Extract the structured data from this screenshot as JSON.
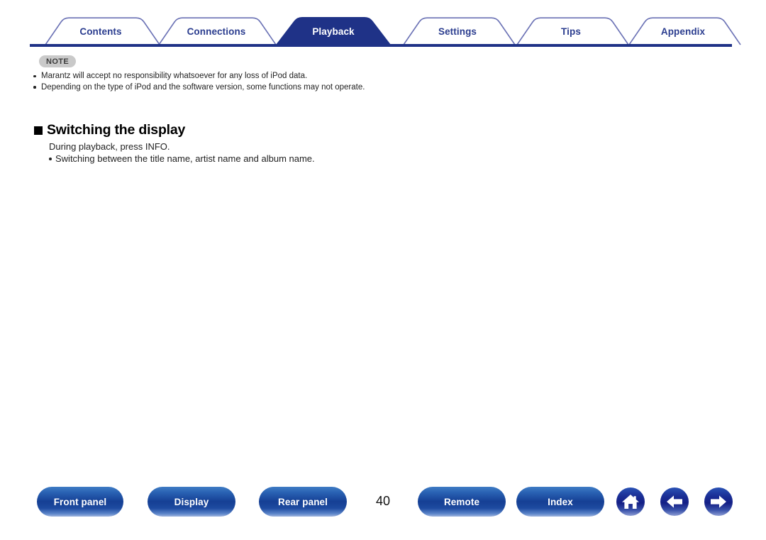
{
  "tabs": [
    {
      "label": "Contents",
      "active": false
    },
    {
      "label": "Connections",
      "active": false
    },
    {
      "label": "Playback",
      "active": true
    },
    {
      "label": "Settings",
      "active": false
    },
    {
      "label": "Tips",
      "active": false
    },
    {
      "label": "Appendix",
      "active": false
    }
  ],
  "note": {
    "badge_label": "NOTE",
    "items": [
      "Marantz will accept no responsibility whatsoever for any loss of iPod data.",
      "Depending on the type of iPod and the software version, some functions may not operate."
    ]
  },
  "section": {
    "heading": "Switching the display",
    "line1": "During playback, press INFO.",
    "line2": "Switching between the title name, artist name and album name."
  },
  "footer": {
    "page_number": "40",
    "buttons": [
      {
        "label": "Front panel"
      },
      {
        "label": "Display"
      },
      {
        "label": "Rear panel"
      },
      {
        "label": "Remote"
      },
      {
        "label": "Index"
      }
    ],
    "icons": [
      {
        "name": "home-icon"
      },
      {
        "name": "arrow-left-icon"
      },
      {
        "name": "arrow-right-icon"
      }
    ]
  },
  "colors": {
    "tab_active_bg": "#1f3287",
    "tab_inactive_text": "#2b3d8f",
    "tab_border": "#6b72b5",
    "baseline": "#1f3287",
    "note_badge_bg": "#c9c9c9",
    "note_badge_text": "#3c3c3c",
    "button_blue": "#153f94"
  }
}
